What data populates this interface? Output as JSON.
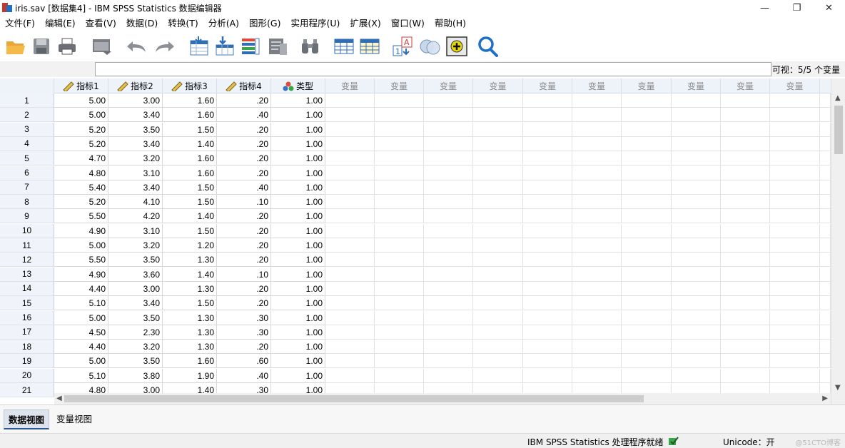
{
  "window": {
    "title": "iris.sav [数据集4] - IBM SPSS Statistics 数据编辑器",
    "controls": {
      "minimize": "—",
      "restore": "❐",
      "close": "✕"
    }
  },
  "menu": [
    "文件(F)",
    "编辑(E)",
    "查看(V)",
    "数据(D)",
    "转换(T)",
    "分析(A)",
    "图形(G)",
    "实用程序(U)",
    "扩展(X)",
    "窗口(W)",
    "帮助(H)"
  ],
  "toolbar": {
    "icons": [
      "open-folder",
      "save",
      "print",
      "dialog-recall",
      "undo",
      "redo",
      "goto-case",
      "goto-variable",
      "variables",
      "run-descriptives",
      "find",
      "insert-cases",
      "insert-variable",
      "split-file",
      "weight-cases",
      "select-cases",
      "value-labels",
      "use-variable-sets",
      "search"
    ]
  },
  "edit_row": {
    "cell_value": "",
    "visible_label": "可视：5/5 个变量"
  },
  "grid": {
    "columns": [
      {
        "name": "指标1",
        "kind": "scale"
      },
      {
        "name": "指标2",
        "kind": "scale"
      },
      {
        "name": "指标3",
        "kind": "scale"
      },
      {
        "name": "指标4",
        "kind": "scale"
      },
      {
        "name": "类型",
        "kind": "nominal"
      }
    ],
    "empty_header": "变量",
    "rows": [
      {
        "n": "1",
        "cells": [
          "5.00",
          "3.00",
          "1.60",
          ".20",
          "1.00"
        ]
      },
      {
        "n": "2",
        "cells": [
          "5.00",
          "3.40",
          "1.60",
          ".40",
          "1.00"
        ]
      },
      {
        "n": "3",
        "cells": [
          "5.20",
          "3.50",
          "1.50",
          ".20",
          "1.00"
        ]
      },
      {
        "n": "4",
        "cells": [
          "5.20",
          "3.40",
          "1.40",
          ".20",
          "1.00"
        ]
      },
      {
        "n": "5",
        "cells": [
          "4.70",
          "3.20",
          "1.60",
          ".20",
          "1.00"
        ]
      },
      {
        "n": "6",
        "cells": [
          "4.80",
          "3.10",
          "1.60",
          ".20",
          "1.00"
        ]
      },
      {
        "n": "7",
        "cells": [
          "5.40",
          "3.40",
          "1.50",
          ".40",
          "1.00"
        ]
      },
      {
        "n": "8",
        "cells": [
          "5.20",
          "4.10",
          "1.50",
          ".10",
          "1.00"
        ]
      },
      {
        "n": "9",
        "cells": [
          "5.50",
          "4.20",
          "1.40",
          ".20",
          "1.00"
        ]
      },
      {
        "n": "10",
        "cells": [
          "4.90",
          "3.10",
          "1.50",
          ".20",
          "1.00"
        ]
      },
      {
        "n": "11",
        "cells": [
          "5.00",
          "3.20",
          "1.20",
          ".20",
          "1.00"
        ]
      },
      {
        "n": "12",
        "cells": [
          "5.50",
          "3.50",
          "1.30",
          ".20",
          "1.00"
        ]
      },
      {
        "n": "13",
        "cells": [
          "4.90",
          "3.60",
          "1.40",
          ".10",
          "1.00"
        ]
      },
      {
        "n": "14",
        "cells": [
          "4.40",
          "3.00",
          "1.30",
          ".20",
          "1.00"
        ]
      },
      {
        "n": "15",
        "cells": [
          "5.10",
          "3.40",
          "1.50",
          ".20",
          "1.00"
        ]
      },
      {
        "n": "16",
        "cells": [
          "5.00",
          "3.50",
          "1.30",
          ".30",
          "1.00"
        ]
      },
      {
        "n": "17",
        "cells": [
          "4.50",
          "2.30",
          "1.30",
          ".30",
          "1.00"
        ]
      },
      {
        "n": "18",
        "cells": [
          "4.40",
          "3.20",
          "1.30",
          ".20",
          "1.00"
        ]
      },
      {
        "n": "19",
        "cells": [
          "5.00",
          "3.50",
          "1.60",
          ".60",
          "1.00"
        ]
      },
      {
        "n": "20",
        "cells": [
          "5.10",
          "3.80",
          "1.90",
          ".40",
          "1.00"
        ]
      },
      {
        "n": "21",
        "cells": [
          "4.80",
          "3.00",
          "1.40",
          ".30",
          "1.00"
        ]
      }
    ]
  },
  "tabs": {
    "data_view": "数据视图",
    "variable_view": "变量视图",
    "active": "data_view"
  },
  "status": {
    "processor": "IBM SPSS Statistics 处理程序就绪",
    "unicode": "Unicode：开",
    "watermark": "@51CTO博客"
  },
  "colors": {
    "header_bg": "#eef3fa",
    "row_number_bg": "#f0f4fa",
    "active_tab": "#dde4ee",
    "toolbar_blue": "#1e6fc7"
  }
}
